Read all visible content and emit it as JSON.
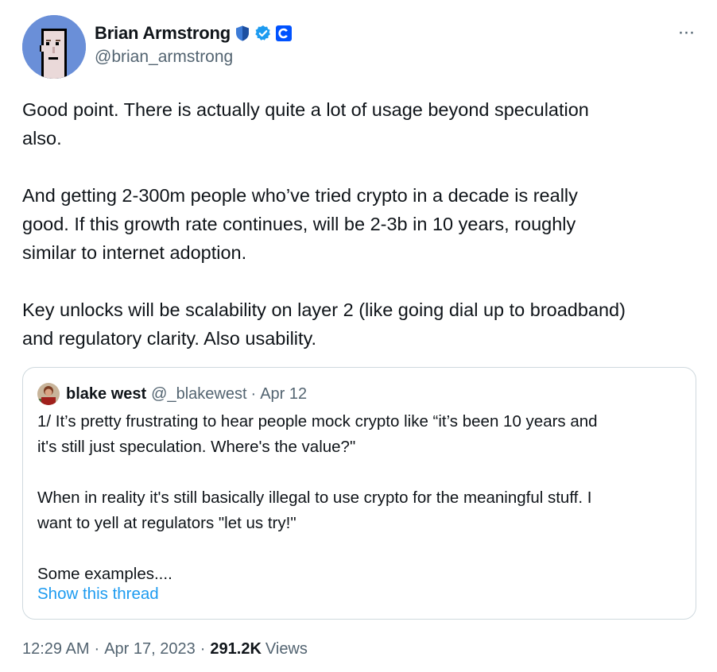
{
  "author": {
    "name": "Brian Armstrong",
    "handle": "@brian_armstrong",
    "avatar_icon": "pixel-punk-avatar",
    "badges": [
      "shield-icon",
      "verified-badge-icon",
      "coinbase-logo-icon"
    ]
  },
  "more_button": {
    "label": "···",
    "icon": "more-horizontal-icon"
  },
  "tweet": {
    "paragraphs": [
      "Good point. There is actually quite a lot of usage beyond speculation\nalso.",
      "And getting 2-300m people who’ve tried crypto in a decade is really\ngood. If this growth rate continues, will be 2-3b in 10 years, roughly\nsimilar to internet adoption.",
      "Key unlocks will be scalability on layer 2 (like going dial up to broadband)\nand regulatory clarity. Also usability."
    ]
  },
  "quote": {
    "name": "blake west",
    "handle": "@_blakewest",
    "separator": "·",
    "date": "Apr 12",
    "paragraphs": [
      "1/ It’s pretty frustrating to hear people mock crypto like “it’s been 10 years and\nit's still just speculation. Where's the value?\"",
      "When in reality it's still basically illegal to use crypto for the meaningful stuff. I\nwant to yell at regulators \"let us try!\"",
      "Some examples...."
    ],
    "show_thread": "Show this thread"
  },
  "meta": {
    "time": "12:29 AM",
    "separator": "·",
    "date": "Apr 17, 2023",
    "views_count": "291.2K",
    "views_label": "Views"
  },
  "colors": {
    "text": "#0f1419",
    "secondary": "#536471",
    "link": "#1d9bf0",
    "verified": "#1d9bf0",
    "border": "#cfd9de"
  }
}
